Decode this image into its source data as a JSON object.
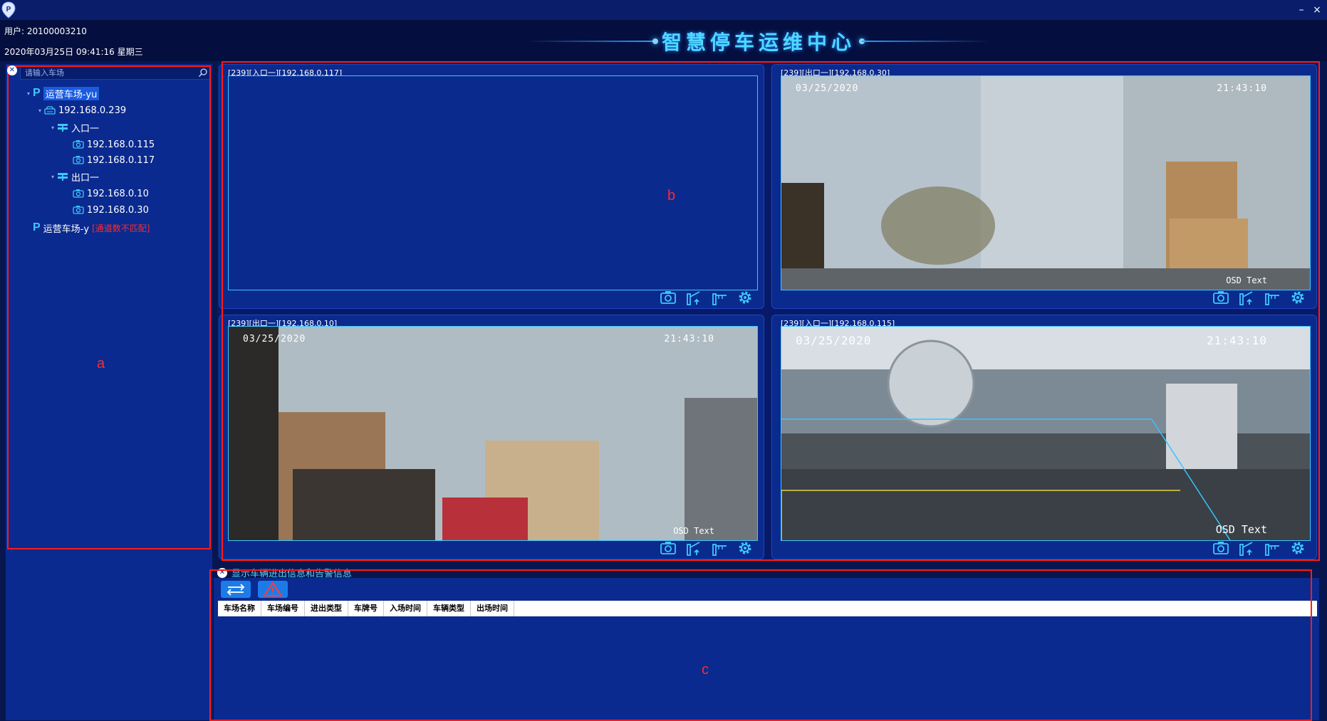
{
  "window": {
    "minimize_label": "–",
    "close_label": "×"
  },
  "header": {
    "user": "用户: 20100003210",
    "datetime": "2020年03月25日 09:41:16 星期三",
    "title": "智慧停车运维中心"
  },
  "sidebar": {
    "search_placeholder": "请输入车场",
    "tree": {
      "lot1": {
        "badge": "P",
        "label": "运营车场-yu"
      },
      "server": {
        "label": "192.168.0.239"
      },
      "entrance": {
        "label": "入口一"
      },
      "cam_115": {
        "label": "192.168.0.115"
      },
      "cam_117": {
        "label": "192.168.0.117"
      },
      "exit": {
        "label": "出口一"
      },
      "cam_10": {
        "label": "192.168.0.10"
      },
      "cam_30": {
        "label": "192.168.0.30"
      },
      "lot2": {
        "badge": "P",
        "label": "运营车场-y",
        "warning": "[通道数不匹配]"
      }
    }
  },
  "videos": [
    {
      "title": "[239][入口一][192.168.0.117]",
      "has_feed": false
    },
    {
      "title": "[239][出口一][192.168.0.30]",
      "has_feed": true,
      "osd_date": "03/25/2020",
      "osd_time": "21:43:10",
      "osd_text": "OSD Text"
    },
    {
      "title": "[239][出口一][192.168.0.10]",
      "has_feed": true,
      "osd_date": "03/25/2020",
      "osd_time": "21:43:10",
      "osd_text": "OSD Text"
    },
    {
      "title": "[239][入口一][192.168.0.115]",
      "has_feed": true,
      "osd_date": "03/25/2020",
      "osd_time": "21:43:10",
      "osd_text": "OSD Text"
    }
  ],
  "info": {
    "title": "显示车辆进出信息和告警信息",
    "columns": [
      "车场名称",
      "车场编号",
      "进出类型",
      "车牌号",
      "入场时间",
      "车辆类型",
      "出场时间"
    ]
  },
  "annotations": {
    "a": "a",
    "b": "b",
    "c": "c"
  },
  "colors": {
    "accent": "#4fd8ff",
    "panel": "#0a2a8f",
    "background": "#08164f",
    "annotation": "#ff1a1a",
    "warning": "#ff2b2b"
  }
}
